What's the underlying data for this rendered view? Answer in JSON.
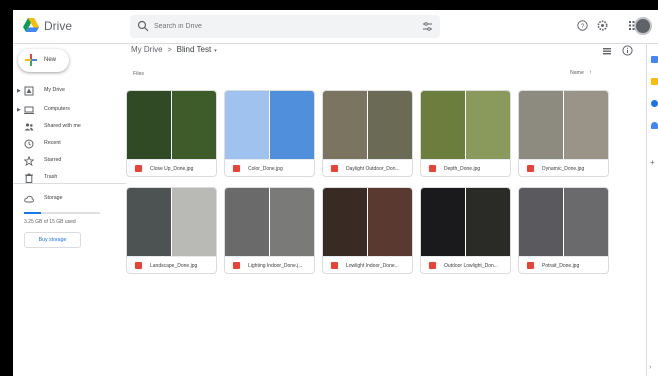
{
  "header": {
    "brand": "Drive",
    "search_placeholder": "Search in Drive",
    "icons": [
      "drive-logo",
      "search-icon",
      "search-options-icon",
      "help-icon",
      "settings-icon",
      "apps-grid-icon",
      "avatar"
    ]
  },
  "sidebar": {
    "new_label": "New",
    "items": [
      {
        "label": "My Drive",
        "icon": "my-drive-icon",
        "expandable": true
      },
      {
        "label": "Computers",
        "icon": "computer-icon",
        "expandable": true
      },
      {
        "label": "Shared with me",
        "icon": "shared-icon",
        "expandable": false
      },
      {
        "label": "Recent",
        "icon": "clock-icon",
        "expandable": false
      },
      {
        "label": "Starred",
        "icon": "star-icon",
        "expandable": false
      },
      {
        "label": "Trash",
        "icon": "trash-icon",
        "expandable": false
      }
    ],
    "storage": {
      "label": "Storage",
      "usage_text": "3.25 GB of 15 GB used",
      "used_fraction": 0.22,
      "buy_label": "Buy storage"
    }
  },
  "main": {
    "breadcrumb": {
      "root": "My Drive",
      "separator": ">",
      "current": "Blind Test",
      "caret": "▾"
    },
    "section_label": "Files",
    "sort": {
      "label": "Name",
      "arrow": "↑"
    },
    "files": [
      {
        "name": "Close Up_Done.jpg",
        "colors": [
          "#2f4a24",
          "#3e5c2a"
        ]
      },
      {
        "name": "Color_Done.jpg",
        "colors": [
          "#9fc3ee",
          "#4f8fdc"
        ]
      },
      {
        "name": "Daylight Outdoor_Don...",
        "colors": [
          "#7a7460",
          "#6a6a55"
        ]
      },
      {
        "name": "Depth_Done.jpg",
        "colors": [
          "#6b7e3e",
          "#8a9a5c"
        ]
      },
      {
        "name": "Dynamic_Done.jpg",
        "colors": [
          "#8d8a80",
          "#9a9488"
        ]
      },
      {
        "name": "Landscape_Done.jpg",
        "colors": [
          "#4c5352",
          "#b9b9b5"
        ]
      },
      {
        "name": "Lighting Indoor_Done.j...",
        "colors": [
          "#6a6a6a",
          "#7a7a78"
        ]
      },
      {
        "name": "Lowlight Indoor_Done...",
        "colors": [
          "#3a2a24",
          "#5a3a30"
        ]
      },
      {
        "name": "Outdoor Lowlight_Don...",
        "colors": [
          "#1a1a1c",
          "#2a2a26"
        ]
      },
      {
        "name": "Potrait_Done.jpg",
        "colors": [
          "#5a5a5e",
          "#6a6a6c"
        ]
      }
    ]
  },
  "colors": {
    "accent": "#1a73e8",
    "file_icon": "#ea4335",
    "border": "#dadce0"
  }
}
